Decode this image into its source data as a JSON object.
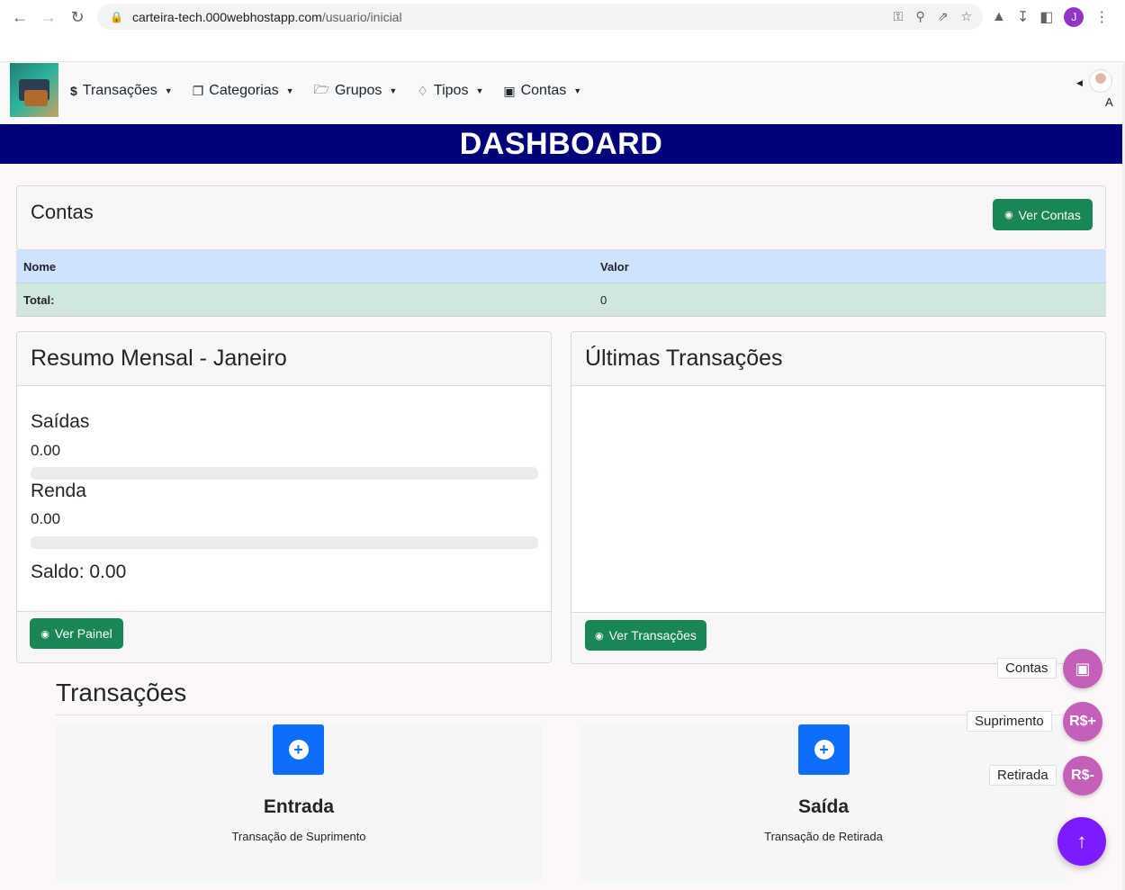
{
  "browser": {
    "url_host": "carteira-tech.000webhostapp.com",
    "url_path": "/usuario/inicial",
    "profile_initial": "J"
  },
  "navbar": {
    "menu": [
      {
        "label": "Transações",
        "icon": "dollar-icon"
      },
      {
        "label": "Categorias",
        "icon": "copy-icon"
      },
      {
        "label": "Grupos",
        "icon": "folder-icon"
      },
      {
        "label": "Tipos",
        "icon": "tag-icon"
      },
      {
        "label": "Contas",
        "icon": "wallet-icon"
      }
    ],
    "user_initial": "A"
  },
  "banner": {
    "title": "DASHBOARD"
  },
  "contas": {
    "title": "Contas",
    "button": "Ver Contas",
    "table": {
      "headers": [
        "Nome",
        "Valor"
      ],
      "total_label": "Total:",
      "total_value": "0"
    }
  },
  "resumo": {
    "title": "Resumo Mensal - Janeiro",
    "saidas_label": "Saídas",
    "saidas_value": "0.00",
    "saidas_progress": 0,
    "renda_label": "Renda",
    "renda_value": "0.00",
    "renda_progress": 0,
    "saldo": "Saldo: 0.00",
    "button": "Ver Painel"
  },
  "ultimas": {
    "title": "Últimas Transações",
    "button": "Ver Transações"
  },
  "transacoes": {
    "title": "Transações",
    "cards": [
      {
        "title": "Entrada",
        "subtitle": "Transação de Suprimento"
      },
      {
        "title": "Saída",
        "subtitle": "Transação de Retirada"
      }
    ]
  },
  "fab": {
    "contas_label": "Contas",
    "suprimento_label": "Suprimento",
    "suprimento_icon_text": "R$+",
    "retirada_label": "Retirada",
    "retirada_icon_text": "R$-",
    "top_icon": "↑"
  },
  "colors": {
    "banner": "#010179",
    "success": "#198754",
    "primary": "#0d6efd",
    "fab": "#c560b8",
    "fab_top": "#7d1bff"
  }
}
